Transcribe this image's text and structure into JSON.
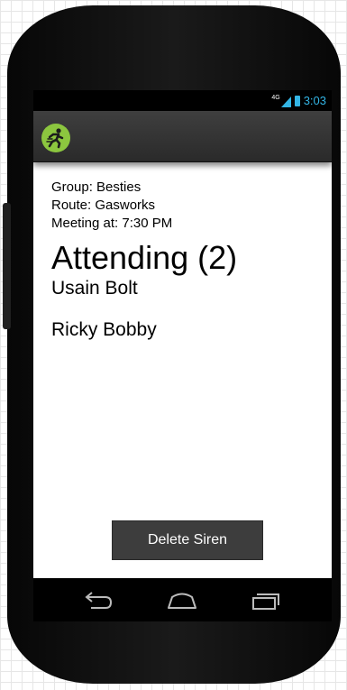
{
  "status_bar": {
    "network": "4G",
    "time": "3:03"
  },
  "action_bar": {
    "app_icon": "runner-icon",
    "accent": "#8cc63f"
  },
  "siren": {
    "group": "Group: Besties",
    "route": "Route: Gasworks",
    "meeting": "Meeting at: 7:30 PM"
  },
  "attending": {
    "heading": "Attending (2)",
    "people": [
      "Usain Bolt",
      "Ricky Bobby"
    ]
  },
  "delete_button": {
    "label": "Delete Siren"
  },
  "nav_bar": {
    "icons": [
      "back-icon",
      "home-icon",
      "recent-apps-icon"
    ]
  },
  "colors": {
    "status_accent": "#33b5e5",
    "button_bg": "#3d3d3d"
  }
}
